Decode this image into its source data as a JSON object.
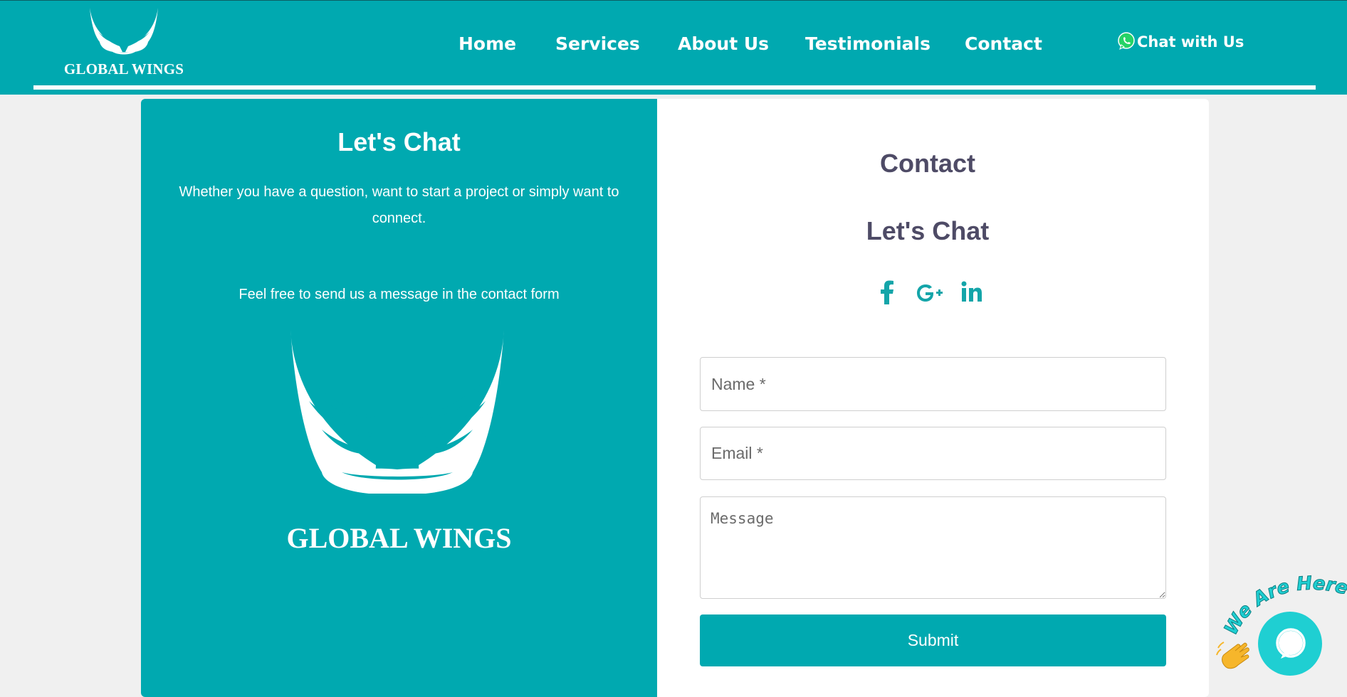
{
  "header": {
    "logo_text": "GLOBAL WINGS",
    "nav": [
      {
        "label": "Home"
      },
      {
        "label": "Services"
      },
      {
        "label": "About Us"
      },
      {
        "label": "Testimonials"
      },
      {
        "label": "Contact"
      }
    ],
    "chat_label": "Chat with Us",
    "chat_icon": "whatsapp-icon"
  },
  "left_panel": {
    "title": "Let's Chat",
    "subtitle": "Whether you have a question, want to start a project or simply want to connect.",
    "note": "Feel free to send us a message in the contact form",
    "logo_text": "GLOBAL WINGS"
  },
  "right_panel": {
    "title": "Contact",
    "subtitle": "Let's Chat",
    "socials": [
      "facebook-icon",
      "google-plus-icon",
      "linkedin-icon"
    ],
    "form": {
      "name_placeholder": "Name *",
      "email_placeholder": "Email *",
      "message_placeholder": "Message",
      "submit_label": "Submit"
    }
  },
  "widget": {
    "badge_text": "We Are Here!"
  },
  "colors": {
    "brand": "#00a9b0",
    "heading": "#4e4b66",
    "widget": "#1fcfd2"
  }
}
